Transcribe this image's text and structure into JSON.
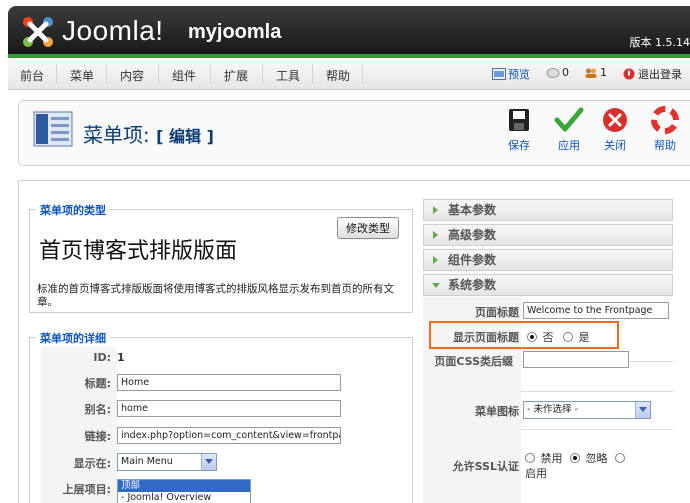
{
  "header": {
    "logo_text": "Joomla!",
    "site_name": "myjoomla",
    "version": "版本 1.5.14"
  },
  "menu": {
    "items": [
      "前台",
      "菜单",
      "内容",
      "组件",
      "扩展",
      "工具",
      "帮助"
    ],
    "preview_label": "预览",
    "messages_count": "0",
    "users_count": "1",
    "logout_label": "退出登录"
  },
  "toolbar": {
    "title": "菜单项:",
    "subtitle": "[ 编辑 ]",
    "buttons": {
      "save": "保存",
      "apply": "应用",
      "close": "关闭",
      "help": "帮助"
    }
  },
  "type_section": {
    "legend": "菜单项的类型",
    "change_button": "修改类型",
    "type_title": "首页博客式排版版面",
    "description": "标准的首页博客式排版版面将使用博客式的排版风格显示发布到首页的所有文章。"
  },
  "details": {
    "legend": "菜单项的详细",
    "id_label": "ID:",
    "id_value": "1",
    "title_label": "标题:",
    "title_value": "Home",
    "alias_label": "别名:",
    "alias_value": "home",
    "link_label": "链接:",
    "link_value": "index.php?option=com_content&view=frontpage",
    "display_label": "显示在:",
    "display_value": "Main Menu",
    "parent_label": "上层项目:",
    "parent_options": [
      "顶部",
      "- Joomla! Overview"
    ]
  },
  "params": {
    "basic": "基本参数",
    "advanced": "高级参数",
    "component": "组件参数",
    "system": "系统参数",
    "page_title_label": "页面标题",
    "page_title_value": "Welcome to the Frontpage",
    "show_title_label": "显示页面标题",
    "no_label": "否",
    "yes_label": "是",
    "css_label": "页面CSS类后缀",
    "menu_image_label": "菜单图标",
    "menu_image_value": "- 未作选择 -",
    "ssl_label": "允许SSL认证",
    "ssl_disable": "禁用",
    "ssl_ignore": "忽略",
    "ssl_enable": "启用"
  },
  "colors": {
    "header_bg": "#1f1f1f",
    "accent_green": "#2ca12f",
    "link_blue": "#0b55c4",
    "highlight": "#f46a1d"
  }
}
